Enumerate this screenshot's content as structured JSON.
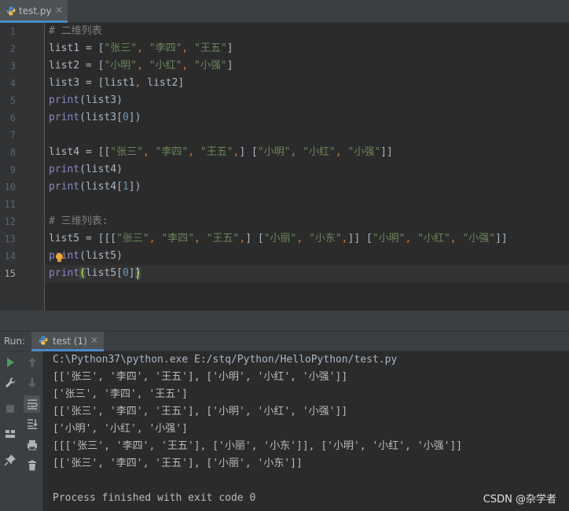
{
  "editor_tab": {
    "filename": "test.py",
    "close_glyph": "✕"
  },
  "line_numbers": [
    "1",
    "2",
    "3",
    "4",
    "5",
    "6",
    "7",
    "8",
    "9",
    "10",
    "11",
    "12",
    "13",
    "14",
    "15"
  ],
  "code": {
    "l1": {
      "comment": "# 二维列表"
    },
    "l2": {
      "var": "list1",
      "eq": " = [",
      "a": "\"张三\"",
      "b": "\"李四\"",
      "c": "\"王五\"",
      "end": "]"
    },
    "l3": {
      "var": "list2",
      "eq": " = [",
      "a": "\"小明\"",
      "b": "\"小红\"",
      "c": "\"小强\"",
      "end": "]"
    },
    "l4": {
      "var": "list3",
      "eq": " = [list1",
      "rest": " list2]"
    },
    "l5": {
      "fn": "print",
      "arg": "(list3)"
    },
    "l6": {
      "fn": "print",
      "pre": "(list3[",
      "num": "0",
      "post": "])"
    },
    "l8": {
      "var": "list4",
      "eq": " = [[",
      "a": "\"张三\"",
      "b": "\"李四\"",
      "c": "\"王五\"",
      "mid": "] [",
      "d": "\"小明\"",
      "e": "\"小红\"",
      "f": "\"小强\"",
      "end": "]]"
    },
    "l9": {
      "fn": "print",
      "arg": "(list4)"
    },
    "l10": {
      "fn": "print",
      "pre": "(list4[",
      "num": "1",
      "post": "])"
    },
    "l12": {
      "comment": "# 三维列表:"
    },
    "l13": {
      "var": "list5",
      "eq": " = [[[",
      "a": "\"张三\"",
      "b": "\"李四\"",
      "c": "\"王五\"",
      "m1": "] [",
      "d": "\"小丽\"",
      "e": "\"小东\"",
      "m2": "]] [",
      "f": "\"小明\"",
      "g": "\"小红\"",
      "h": "\"小强\"",
      "end": "]]"
    },
    "l14": {
      "fn": "print",
      "arg": "(list5)"
    },
    "l15": {
      "fn": "print",
      "open": "(",
      "pre": "list5[",
      "num": "0",
      "post": "]",
      "close": ")"
    }
  },
  "run_panel": {
    "label": "Run:",
    "tab": "test (1)",
    "close_glyph": "✕"
  },
  "console": {
    "lines": [
      "C:\\Python37\\python.exe E:/stq/Python/HelloPython/test.py",
      "[['张三', '李四', '王五'], ['小明', '小红', '小强']]",
      "['张三', '李四', '王五']",
      "[['张三', '李四', '王五'], ['小明', '小红', '小强']]",
      "['小明', '小红', '小强']",
      "[[['张三', '李四', '王五'], ['小丽', '小东']], ['小明', '小红', '小强']]",
      "[['张三', '李四', '王五'], ['小丽', '小东']]",
      "",
      "Process finished with exit code 0"
    ]
  },
  "watermark": "CSDN @杂学者",
  "colors": {
    "keyword_orange": "#cc7832",
    "string_green": "#6a8759",
    "number_blue": "#6897bb",
    "builtin_purple": "#8888c6",
    "comment_gray": "#808080",
    "accent": "#4a88c7"
  },
  "icons": {
    "run": "play-icon",
    "wrench": "wrench-icon",
    "stop": "stop-icon",
    "layout": "layout-icon",
    "pin": "pin-icon",
    "up": "arrow-up-icon",
    "down": "arrow-down-icon",
    "wrap": "soft-wrap-icon",
    "scroll": "scroll-to-end-icon",
    "print": "print-icon",
    "trash": "trash-icon",
    "bulb": "lightbulb-icon"
  }
}
